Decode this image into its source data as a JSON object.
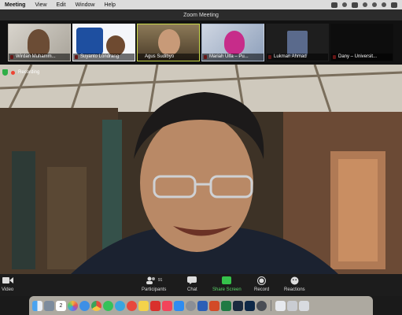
{
  "menubar": {
    "items": [
      "Meeting",
      "View",
      "Edit",
      "Window",
      "Help"
    ]
  },
  "window": {
    "title": "Zoom Meeting"
  },
  "gallery": {
    "participants": [
      {
        "name": "Wirdan Muhamm..."
      },
      {
        "name": "Suyanto Londrang"
      },
      {
        "name": "Agus Sudibyo",
        "active": true
      },
      {
        "name": "Mariah Ulfa – Pu..."
      },
      {
        "name": "Lukman Ahmad"
      },
      {
        "name": "Dany – Universit..."
      }
    ]
  },
  "status": {
    "recording_label": "Recording"
  },
  "toolbar": {
    "video_label": "Video",
    "participants_label": "Participants",
    "participants_count": "91",
    "chat_label": "Chat",
    "share_label": "Share Screen",
    "record_label": "Record",
    "reactions_label": "Reactions"
  },
  "dock": {
    "calendar_day": "2",
    "apps": [
      "finder",
      "launchpad",
      "calendar",
      "photos",
      "safari",
      "chrome",
      "whatsapp",
      "telegram",
      "google",
      "notes",
      "acrobat",
      "music",
      "appstore",
      "settings",
      "word",
      "powerpoint",
      "excel",
      "lightroom",
      "photoshop",
      "quicktime",
      "preview",
      "trash"
    ]
  }
}
